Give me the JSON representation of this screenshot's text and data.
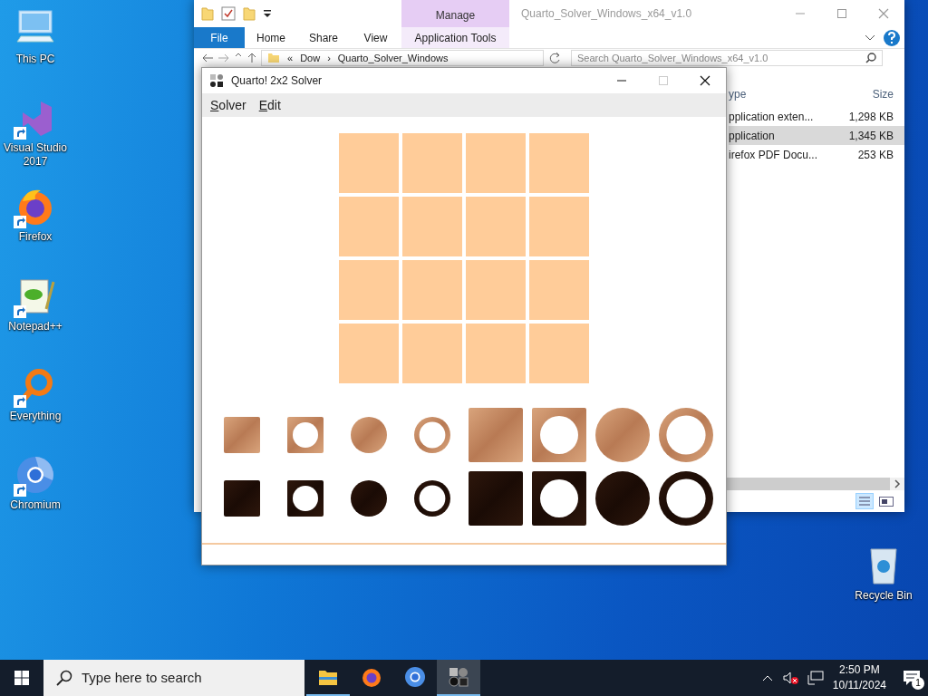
{
  "desktop_icons": [
    {
      "label": "This PC",
      "kind": "pc",
      "shortcut": false
    },
    {
      "label": "Visual Studio 2017",
      "kind": "vs",
      "shortcut": true
    },
    {
      "label": "Firefox",
      "kind": "firefox",
      "shortcut": true
    },
    {
      "label": "Notepad++",
      "kind": "notepad",
      "shortcut": true
    },
    {
      "label": "Everything",
      "kind": "everything",
      "shortcut": true
    },
    {
      "label": "Chromium",
      "kind": "chromium",
      "shortcut": true
    }
  ],
  "recycle_bin": {
    "label": "Recycle Bin"
  },
  "explorer": {
    "title": "Quarto_Solver_Windows_x64_v1.0",
    "context_tab": "Manage",
    "ribbon_tabs": [
      {
        "label": "File",
        "kind": "file"
      },
      {
        "label": "Home",
        "kind": "plain"
      },
      {
        "label": "Share",
        "kind": "plain"
      },
      {
        "label": "View",
        "kind": "plain"
      },
      {
        "label": "Application Tools",
        "kind": "context"
      }
    ],
    "address": [
      "«",
      "Dow",
      "›",
      "Quarto_Solver_Windows"
    ],
    "search": {
      "placeholder": "Search Quarto_Solver_Windows_x64_v1.0"
    },
    "columns": [
      "ype",
      "Size"
    ],
    "rows": [
      {
        "type": "pplication exten...",
        "size": "1,298 KB",
        "selected": false
      },
      {
        "type": "pplication",
        "size": "1,345 KB",
        "selected": true
      },
      {
        "type": "irefox PDF Docu...",
        "size": "253 KB",
        "selected": false
      }
    ]
  },
  "solver": {
    "title": "Quarto! 2x2 Solver",
    "menu": [
      "Solver",
      "Edit"
    ],
    "pieces": [
      {
        "dark": false,
        "tall": false,
        "round": false,
        "hollow": false
      },
      {
        "dark": false,
        "tall": false,
        "round": false,
        "hollow": true
      },
      {
        "dark": false,
        "tall": false,
        "round": true,
        "hollow": false
      },
      {
        "dark": false,
        "tall": false,
        "round": true,
        "hollow": true
      },
      {
        "dark": false,
        "tall": true,
        "round": false,
        "hollow": false
      },
      {
        "dark": false,
        "tall": true,
        "round": false,
        "hollow": true
      },
      {
        "dark": false,
        "tall": true,
        "round": true,
        "hollow": false
      },
      {
        "dark": false,
        "tall": true,
        "round": true,
        "hollow": true
      },
      {
        "dark": true,
        "tall": false,
        "round": false,
        "hollow": false
      },
      {
        "dark": true,
        "tall": false,
        "round": false,
        "hollow": true
      },
      {
        "dark": true,
        "tall": false,
        "round": true,
        "hollow": false
      },
      {
        "dark": true,
        "tall": false,
        "round": true,
        "hollow": true
      },
      {
        "dark": true,
        "tall": true,
        "round": false,
        "hollow": false
      },
      {
        "dark": true,
        "tall": true,
        "round": false,
        "hollow": true
      },
      {
        "dark": true,
        "tall": true,
        "round": true,
        "hollow": false
      },
      {
        "dark": true,
        "tall": true,
        "round": true,
        "hollow": true
      }
    ]
  },
  "taskbar": {
    "search_placeholder": "Type here to search",
    "apps": [
      {
        "kind": "explorer",
        "running": true,
        "active": false
      },
      {
        "kind": "firefox",
        "running": false,
        "active": false
      },
      {
        "kind": "chromium",
        "running": false,
        "active": false
      },
      {
        "kind": "quarto",
        "running": true,
        "active": true
      }
    ],
    "time": "2:50 PM",
    "date": "10/11/2024",
    "notifications": "1"
  }
}
